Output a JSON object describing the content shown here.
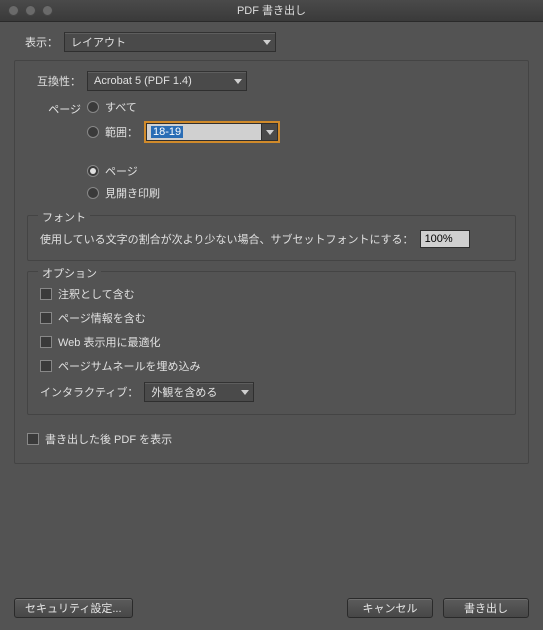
{
  "title": "PDF 書き出し",
  "display": {
    "label": "表示：",
    "value": "レイアウト"
  },
  "compat": {
    "label": "互換性：",
    "value": "Acrobat 5 (PDF 1.4)"
  },
  "pages": {
    "label": "ページ",
    "all": "すべて",
    "range_label": "範囲：",
    "range_value": "18-19",
    "pages_radio": "ページ",
    "spreads": "見開き印刷"
  },
  "font": {
    "legend": "フォント",
    "subset_label": "使用している文字の割合が次より少ない場合、サブセットフォントにする：",
    "subset_value": "100%"
  },
  "options": {
    "legend": "オプション",
    "include_annotations": "注釈として含む",
    "include_page_info": "ページ情報を含む",
    "optimize_web": "Web 表示用に最適化",
    "embed_thumbnails": "ページサムネールを埋め込み",
    "interactive_label": "インタラクティブ：",
    "interactive_value": "外観を含める"
  },
  "view_after": "書き出した後 PDF を表示",
  "buttons": {
    "security": "セキュリティ設定...",
    "cancel": "キャンセル",
    "export": "書き出し"
  }
}
